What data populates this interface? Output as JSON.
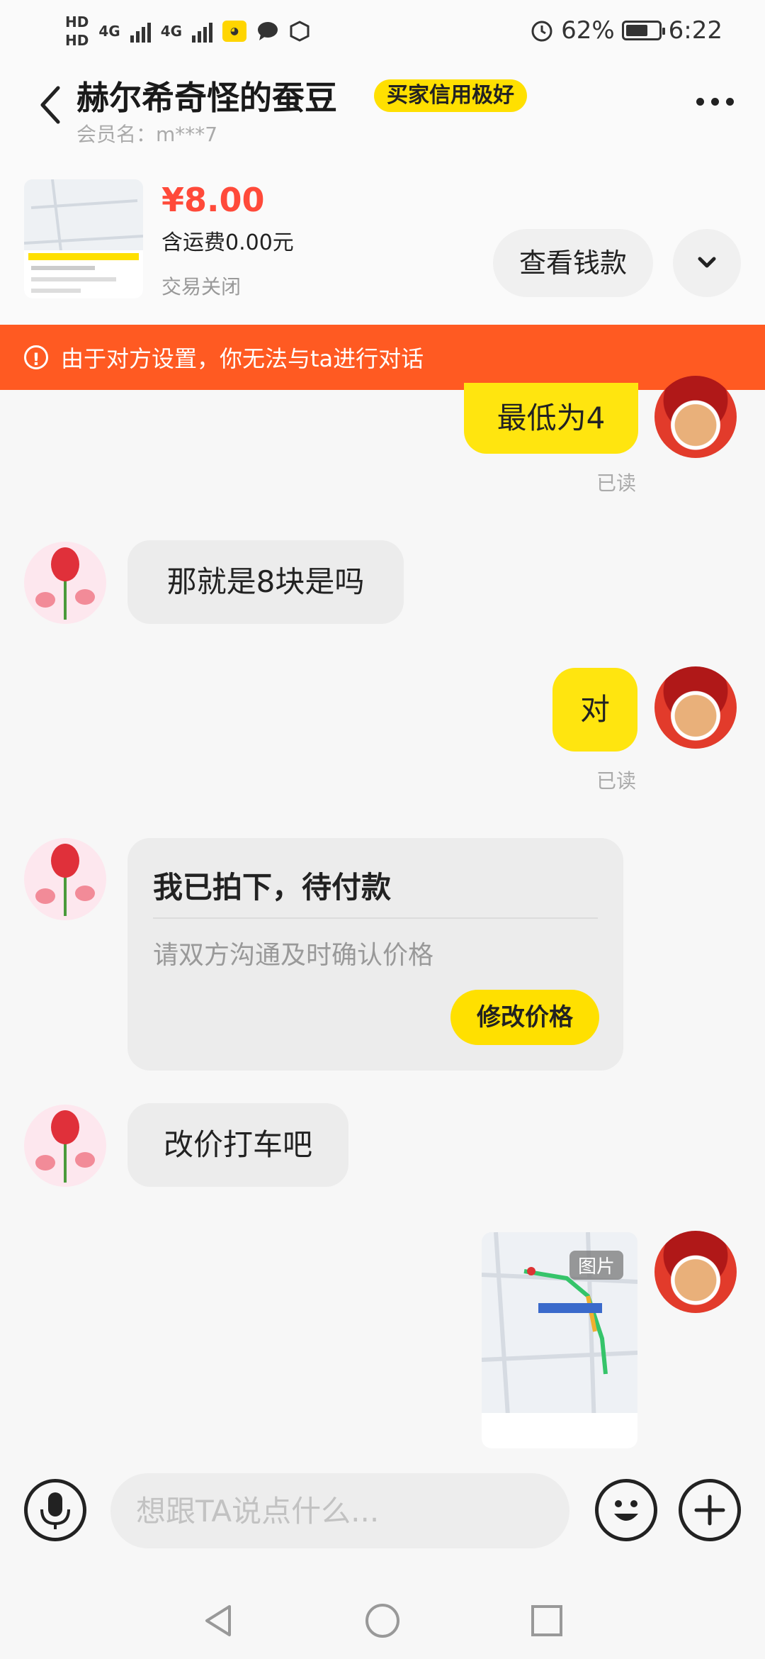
{
  "status_bar": {
    "hd1": "HD",
    "hd2": "HD",
    "sim1_network": "4G",
    "sim2_network": "4G",
    "battery": "62%",
    "time": "6:22"
  },
  "header": {
    "title": "赫尔希奇怪的蚕豆",
    "badge": "买家信用极好",
    "member": "会员名：m***7"
  },
  "product": {
    "price": "¥8.00",
    "shipping": "含运费0.00元",
    "status": "交易关闭",
    "view_payment": "查看钱款"
  },
  "banner": {
    "text": "由于对方设置，你无法与ta进行对话"
  },
  "messages": {
    "m1": {
      "text": "最低为4",
      "read": "已读"
    },
    "m2": {
      "text": "那就是8块是吗"
    },
    "m3": {
      "text": "对",
      "read": "已读"
    },
    "card": {
      "title": "我已拍下，待付款",
      "subtitle": "请双方沟通及时确认价格",
      "button": "修改价格"
    },
    "m5": {
      "text": "改价打车吧"
    },
    "m6": {
      "image_tag": "图片"
    }
  },
  "input": {
    "placeholder": "想跟TA说点什么..."
  },
  "colors": {
    "accent_yellow": "#ffe000",
    "banner_orange": "#ff5a22",
    "price_red": "#ff4a3a"
  },
  "icons": [
    "back-icon",
    "more-icon",
    "chevron-down-icon",
    "warning-icon",
    "microphone-icon",
    "emoji-icon",
    "plus-icon",
    "nav-back-icon",
    "nav-home-icon",
    "nav-recents-icon"
  ]
}
